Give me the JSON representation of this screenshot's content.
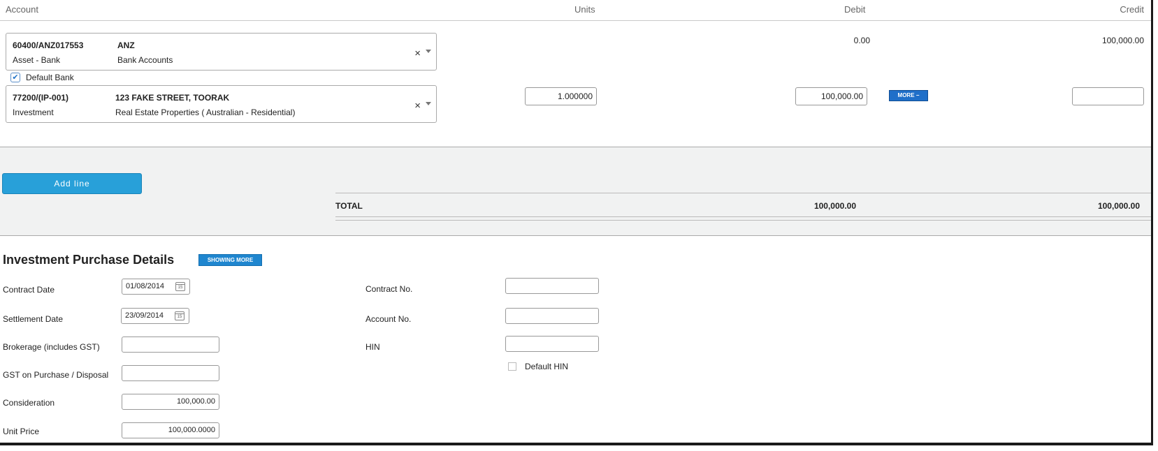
{
  "columns": {
    "account": "Account",
    "units": "Units",
    "debit": "Debit",
    "credit": "Credit"
  },
  "lines": [
    {
      "code": "60400/ANZ017553",
      "name": "ANZ",
      "type": "Asset - Bank",
      "category": "Bank Accounts",
      "clear_icon": "×",
      "debit": "0.00",
      "credit": "100,000.00"
    },
    {
      "code": "77200/(IP-001)",
      "name": "123 FAKE STREET, TOORAK",
      "type": "Investment",
      "category": "Real Estate Properties ( Australian - Residential)",
      "clear_icon": "×",
      "units": "1.000000",
      "debit": "100,000.00",
      "more_label": "MORE  −",
      "credit": ""
    }
  ],
  "default_bank": {
    "checked": true,
    "check_mark": "✔",
    "label": "Default Bank"
  },
  "add_line_label": "Add line",
  "totals": {
    "label": "TOTAL",
    "debit": "100,000.00",
    "credit": "100,000.00"
  },
  "purchase_details": {
    "title": "Investment Purchase Details",
    "showing_more_label": "SHOWING MORE",
    "contract_date": {
      "label": "Contract Date",
      "value": "01/08/2014",
      "calendar_day": "15"
    },
    "settlement_date": {
      "label": "Settlement Date",
      "value": "23/09/2014",
      "calendar_day": "15"
    },
    "brokerage": {
      "label": "Brokerage (includes GST)",
      "value": ""
    },
    "gst": {
      "label": "GST on Purchase / Disposal",
      "value": ""
    },
    "consideration": {
      "label": "Consideration",
      "value": "100,000.00"
    },
    "unit_price": {
      "label": "Unit Price",
      "value": "100,000.0000"
    },
    "contract_no": {
      "label": "Contract No.",
      "value": ""
    },
    "account_no": {
      "label": "Account No.",
      "value": ""
    },
    "hin": {
      "label": "HIN",
      "value": ""
    },
    "default_hin": {
      "label": "Default HIN",
      "checked": false
    }
  },
  "colors": {
    "accent_blue": "#28a0d9",
    "more_button_blue": "#1f6fc9",
    "band_grey": "#f1f2f2"
  }
}
